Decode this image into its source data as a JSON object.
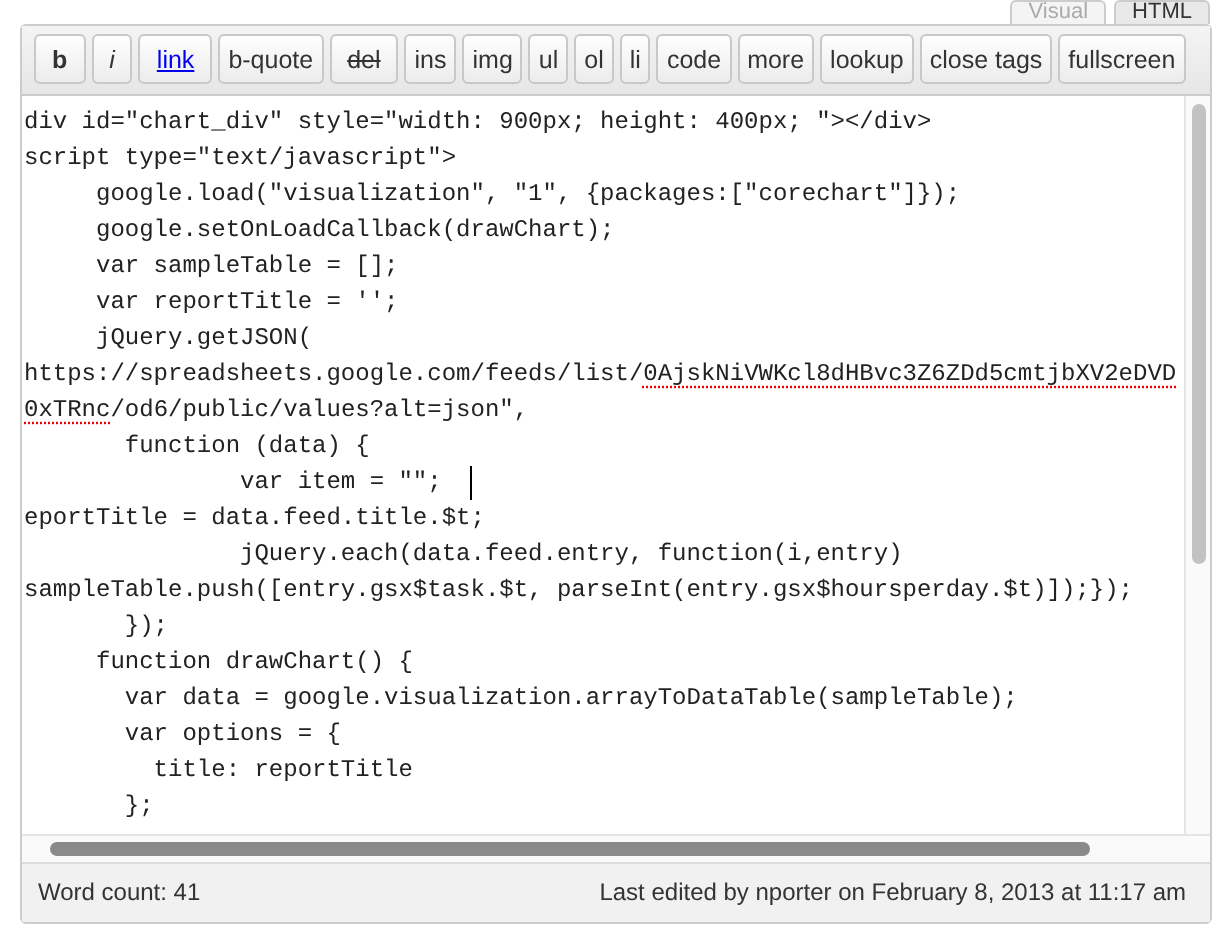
{
  "tabs": [
    {
      "label": "Visual",
      "selected": false
    },
    {
      "label": "HTML",
      "selected": true
    }
  ],
  "toolbar": [
    {
      "label": "b",
      "kind": "bold"
    },
    {
      "label": "i",
      "kind": "italic"
    },
    {
      "label": "link",
      "kind": "link"
    },
    {
      "label": "b-quote",
      "kind": "plain"
    },
    {
      "label": "del",
      "kind": "strike"
    },
    {
      "label": "ins",
      "kind": "plain"
    },
    {
      "label": "img",
      "kind": "plain"
    },
    {
      "label": "ul",
      "kind": "plain"
    },
    {
      "label": "ol",
      "kind": "plain"
    },
    {
      "label": "li",
      "kind": "plain"
    },
    {
      "label": "code",
      "kind": "plain"
    },
    {
      "label": "more",
      "kind": "plain"
    },
    {
      "label": "lookup",
      "kind": "plain"
    },
    {
      "label": "close tags",
      "kind": "plain"
    },
    {
      "label": "fullscreen",
      "kind": "plain"
    }
  ],
  "editor": {
    "lines": [
      {
        "caret": false,
        "segments": [
          {
            "text": "div id=\"chart_div\" style=\"width: 900px; height: 400px; \"></div>",
            "misspelled": false
          }
        ]
      },
      {
        "caret": false,
        "segments": [
          {
            "text": "script type=\"text/javascript\">",
            "misspelled": false
          }
        ]
      },
      {
        "caret": false,
        "segments": [
          {
            "text": "     google.load(\"visualization\", \"1\", {packages:[\"corechart\"]});",
            "misspelled": false
          }
        ]
      },
      {
        "caret": false,
        "segments": [
          {
            "text": "     google.setOnLoadCallback(drawChart);",
            "misspelled": false
          }
        ]
      },
      {
        "caret": false,
        "segments": [
          {
            "text": "     var sampleTable = [];",
            "misspelled": false
          }
        ]
      },
      {
        "caret": false,
        "segments": [
          {
            "text": "     var reportTitle = '';",
            "misspelled": false
          }
        ]
      },
      {
        "caret": false,
        "segments": [
          {
            "text": "     jQuery.getJSON(",
            "misspelled": false
          }
        ]
      },
      {
        "caret": false,
        "segments": [
          {
            "text": "https://spreadsheets.google.com/feeds/list/",
            "misspelled": false
          },
          {
            "text": "0AjskNiVWKcl8dHBvc3Z6ZDd5cmtjbXV2eDVD",
            "misspelled": true
          }
        ]
      },
      {
        "caret": false,
        "segments": [
          {
            "text": "0xTRnc",
            "misspelled": true
          },
          {
            "text": "/od6/public/values?alt=json\",",
            "misspelled": false
          }
        ]
      },
      {
        "caret": false,
        "segments": [
          {
            "text": "       function (data) {",
            "misspelled": false
          }
        ]
      },
      {
        "caret": true,
        "segments": [
          {
            "text": "               var item = \"\";",
            "misspelled": false
          }
        ]
      },
      {
        "caret": false,
        "segments": [
          {
            "text": "eportTitle = data.feed.title.$t;",
            "misspelled": false
          }
        ]
      },
      {
        "caret": false,
        "segments": [
          {
            "text": "               jQuery.each(data.feed.entry, function(i,entry)",
            "misspelled": false
          }
        ]
      },
      {
        "caret": false,
        "segments": [
          {
            "text": "sampleTable.push([entry.gsx$task.$t, parseInt(entry.gsx$hoursperday.$t)]);});",
            "misspelled": false
          }
        ]
      },
      {
        "caret": false,
        "segments": [
          {
            "text": "       });",
            "misspelled": false
          }
        ]
      },
      {
        "caret": false,
        "segments": [
          {
            "text": "     function drawChart() {",
            "misspelled": false
          }
        ]
      },
      {
        "caret": false,
        "segments": [
          {
            "text": "       var data = google.visualization.arrayToDataTable(sampleTable);",
            "misspelled": false
          }
        ]
      },
      {
        "caret": false,
        "segments": [
          {
            "text": "       var options = {",
            "misspelled": false
          }
        ]
      },
      {
        "caret": false,
        "segments": [
          {
            "text": "         title: reportTitle",
            "misspelled": false
          }
        ]
      },
      {
        "caret": false,
        "segments": [
          {
            "text": "       };",
            "misspelled": false
          }
        ]
      }
    ]
  },
  "status_bar": {
    "word_count": "Word count: 41",
    "last_edited": "Last edited by nporter on February 8, 2013 at 11:17 am"
  }
}
